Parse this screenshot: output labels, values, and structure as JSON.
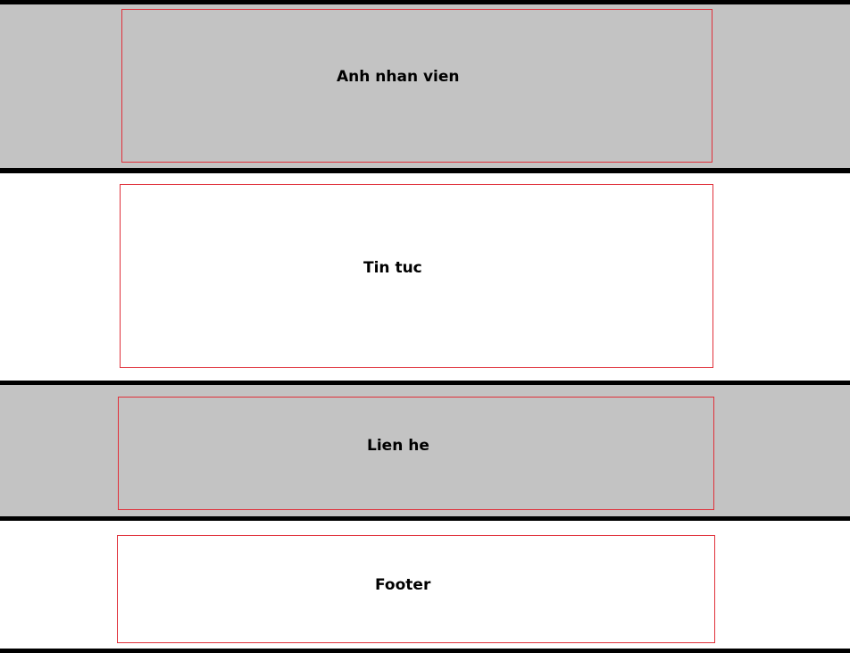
{
  "sections": [
    {
      "label": "Anh nhan vien",
      "background": "#c3c3c3"
    },
    {
      "label": "Tin tuc",
      "background": "#ffffff"
    },
    {
      "label": "Lien he",
      "background": "#c3c3c3"
    },
    {
      "label": "Footer",
      "background": "#ffffff"
    }
  ],
  "colors": {
    "divider": "#000000",
    "box_border": "#e0303a",
    "gray_band": "#c3c3c3"
  }
}
